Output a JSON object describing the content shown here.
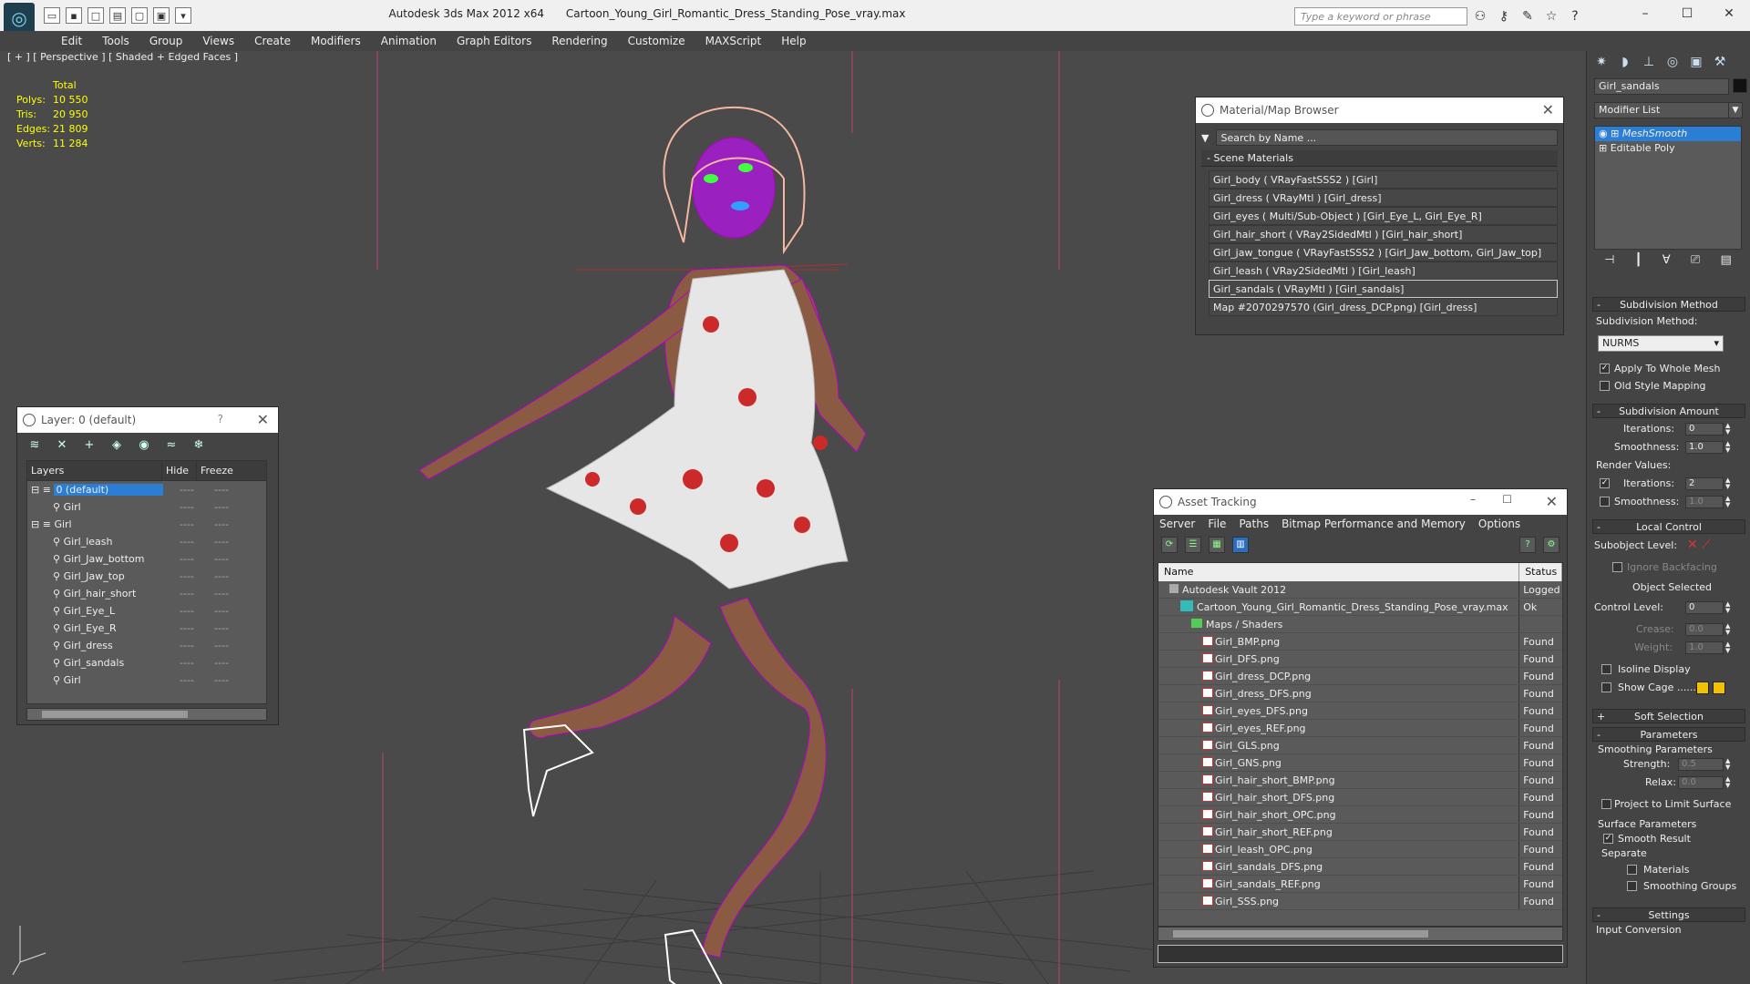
{
  "titlebar": {
    "app_title": "Autodesk 3ds Max  2012 x64",
    "file_title": "Cartoon_Young_Girl_Romantic_Dress_Standing_Pose_vray.max",
    "search_placeholder": "Type a keyword or phrase"
  },
  "menu": [
    "Edit",
    "Tools",
    "Group",
    "Views",
    "Create",
    "Modifiers",
    "Animation",
    "Graph Editors",
    "Rendering",
    "Customize",
    "MAXScript",
    "Help"
  ],
  "viewport": {
    "label": "[ + ] [ Perspective ] [ Shaded + Edged Faces ]",
    "stats_header": "Total",
    "stats": [
      {
        "label": "Polys:",
        "value": "10 550"
      },
      {
        "label": "Tris:",
        "value": "20 950"
      },
      {
        "label": "Edges:",
        "value": "21 809"
      },
      {
        "label": "Verts:",
        "value": "11 284"
      }
    ]
  },
  "layer_manager": {
    "title": "Layer: 0 (default)",
    "col_layers": "Layers",
    "col_hide": "Hide",
    "col_freeze": "Freeze",
    "rows": [
      {
        "name": "0 (default)",
        "indent": 0,
        "selected": true
      },
      {
        "name": "Girl",
        "indent": 2,
        "selected": false
      },
      {
        "name": "Girl",
        "indent": 0,
        "selected": false
      },
      {
        "name": "Girl_leash",
        "indent": 2,
        "selected": false
      },
      {
        "name": "Girl_Jaw_bottom",
        "indent": 2,
        "selected": false
      },
      {
        "name": "Girl_Jaw_top",
        "indent": 2,
        "selected": false
      },
      {
        "name": "Girl_hair_short",
        "indent": 2,
        "selected": false
      },
      {
        "name": "Girl_Eye_L",
        "indent": 2,
        "selected": false
      },
      {
        "name": "Girl_Eye_R",
        "indent": 2,
        "selected": false
      },
      {
        "name": "Girl_dress",
        "indent": 2,
        "selected": false
      },
      {
        "name": "Girl_sandals",
        "indent": 2,
        "selected": false
      },
      {
        "name": "Girl",
        "indent": 2,
        "selected": false
      }
    ]
  },
  "material_browser": {
    "title": "Material/Map Browser",
    "search_placeholder": "Search by Name ...",
    "section": "Scene Materials",
    "items": [
      "Girl_body  ( VRayFastSSS2 ) [Girl]",
      "Girl_dress  ( VRayMtl ) [Girl_dress]",
      "Girl_eyes  ( Multi/Sub-Object ) [Girl_Eye_L, Girl_Eye_R]",
      "Girl_hair_short  ( VRay2SidedMtl ) [Girl_hair_short]",
      "Girl_jaw_tongue  ( VRayFastSSS2 ) [Girl_Jaw_bottom, Girl_Jaw_top]",
      "Girl_leash  ( VRay2SidedMtl ) [Girl_leash]",
      "Girl_sandals  ( VRayMtl ) [Girl_sandals]",
      "Map #2070297570 (Girl_dress_DCP.png) [Girl_dress]"
    ],
    "selected_index": 6
  },
  "asset_tracking": {
    "title": "Asset Tracking",
    "menu": [
      "Server",
      "File",
      "Paths",
      "Bitmap Performance and Memory",
      "Options"
    ],
    "col_name": "Name",
    "col_status": "Status",
    "rows": [
      {
        "name": "Autodesk Vault 2012",
        "status": "Logged O",
        "kind": "vault",
        "indent": 1
      },
      {
        "name": "Cartoon_Young_Girl_Romantic_Dress_Standing_Pose_vray.max",
        "status": "Ok",
        "kind": "max",
        "indent": 2
      },
      {
        "name": "Maps / Shaders",
        "status": "",
        "kind": "folder",
        "indent": 3
      },
      {
        "name": "Girl_BMP.png",
        "status": "Found",
        "kind": "png",
        "indent": 4
      },
      {
        "name": "Girl_DFS.png",
        "status": "Found",
        "kind": "png",
        "indent": 4
      },
      {
        "name": "Girl_dress_DCP.png",
        "status": "Found",
        "kind": "png",
        "indent": 4
      },
      {
        "name": "Girl_dress_DFS.png",
        "status": "Found",
        "kind": "png",
        "indent": 4
      },
      {
        "name": "Girl_eyes_DFS.png",
        "status": "Found",
        "kind": "png",
        "indent": 4
      },
      {
        "name": "Girl_eyes_REF.png",
        "status": "Found",
        "kind": "png",
        "indent": 4
      },
      {
        "name": "Girl_GLS.png",
        "status": "Found",
        "kind": "png",
        "indent": 4
      },
      {
        "name": "Girl_GNS.png",
        "status": "Found",
        "kind": "png",
        "indent": 4
      },
      {
        "name": "Girl_hair_short_BMP.png",
        "status": "Found",
        "kind": "png",
        "indent": 4
      },
      {
        "name": "Girl_hair_short_DFS.png",
        "status": "Found",
        "kind": "png",
        "indent": 4
      },
      {
        "name": "Girl_hair_short_OPC.png",
        "status": "Found",
        "kind": "png",
        "indent": 4
      },
      {
        "name": "Girl_hair_short_REF.png",
        "status": "Found",
        "kind": "png",
        "indent": 4
      },
      {
        "name": "Girl_leash_OPC.png",
        "status": "Found",
        "kind": "png",
        "indent": 4
      },
      {
        "name": "Girl_sandals_DFS.png",
        "status": "Found",
        "kind": "png",
        "indent": 4
      },
      {
        "name": "Girl_sandals_REF.png",
        "status": "Found",
        "kind": "png",
        "indent": 4
      },
      {
        "name": "Girl_SSS.png",
        "status": "Found",
        "kind": "png",
        "indent": 4
      }
    ]
  },
  "command_panel": {
    "object_name": "Girl_sandals",
    "modifier_list": "Modifier List",
    "stack": [
      "MeshSmooth",
      "Editable Poly"
    ],
    "subdivision_method": {
      "rollout": "Subdivision Method",
      "label": "Subdivision Method:",
      "value": "NURMS",
      "apply_whole_mesh": "Apply To Whole Mesh",
      "old_style": "Old Style Mapping"
    },
    "subdivision_amount": {
      "rollout": "Subdivision Amount",
      "iterations_label": "Iterations:",
      "iterations": "0",
      "smoothness_label": "Smoothness:",
      "smoothness": "1.0",
      "render_values": "Render Values:",
      "r_iterations_label": "Iterations:",
      "r_iterations": "2",
      "r_smoothness_label": "Smoothness:",
      "r_smoothness": "1.0"
    },
    "local_control": {
      "rollout": "Local Control",
      "subobject_level": "Subobject Level:",
      "ignore_backfacing": "Ignore Backfacing",
      "object_selected": "Object Selected",
      "control_level_label": "Control Level:",
      "control_level": "0",
      "crease_label": "Crease:",
      "crease": "0.0",
      "weight_label": "Weight:",
      "weight": "1.0",
      "isoline": "Isoline Display",
      "show_cage": "Show Cage ......"
    },
    "soft_selection": "Soft Selection",
    "parameters": {
      "rollout": "Parameters",
      "smoothing_params": "Smoothing Parameters",
      "strength_label": "Strength:",
      "strength": "0.5",
      "relax_label": "Relax:",
      "relax": "0.0",
      "project_limit": "Project to Limit Surface",
      "surface_params": "Surface Parameters",
      "smooth_result": "Smooth Result",
      "separate": "Separate",
      "materials": "Materials",
      "smoothing_groups": "Smoothing Groups"
    },
    "settings": "Settings",
    "input_conversion": "Input Conversion"
  },
  "colors": {
    "wire": "#b400c8",
    "skin": "#8a5a42",
    "hair_wire": "#f4b7a0",
    "selection_blue": "#2a7fd4",
    "stats_yellow": "#ffff00"
  }
}
